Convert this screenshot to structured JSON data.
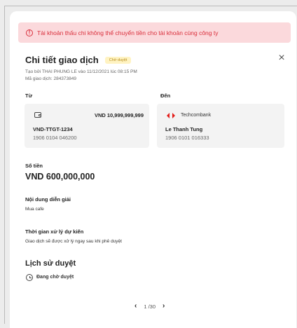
{
  "alert": {
    "icon": "alert-circle-icon",
    "text": "Tài khoản thấu chi không thể chuyển tiền cho tài khoản cùng công ty",
    "color": "#d92d3a",
    "background": "#fbd9dc"
  },
  "header": {
    "title": "Chi tiết giao dịch",
    "status_badge": "Chờ duyệt",
    "created_by": "Tạo bởi THAI PHUNG LE vào 11/12/2021 lúc 08:15 PM",
    "transaction_id": "Mã giao dịch: 284373849"
  },
  "from": {
    "label": "Từ",
    "icon": "wallet-icon",
    "balance": "VND 10,999,999,999",
    "account_name": "VND-TTGT-1234",
    "account_number": "1906 0104 046200"
  },
  "to": {
    "label": "Đến",
    "bank_icon": "techcombank-logo-icon",
    "bank_name": "Techcombank",
    "account_name": "Le Thanh Tung",
    "account_number": "1906 0101 016333"
  },
  "amount": {
    "label": "Số tiền",
    "value": "VND 600,000,000"
  },
  "description": {
    "label": "Nội dung diễn giải",
    "value": "Mua cafe"
  },
  "processing_time": {
    "label": "Thời gian xử lý dự kiến",
    "value": "Giao dịch sẽ được xử lý ngay sau khi phê duyệt"
  },
  "approval_history": {
    "title": "Lịch sử duyệt",
    "icon": "clock-icon",
    "status": "Đang chờ duyệt"
  },
  "pagination": {
    "current": "1",
    "text": "1 /30"
  },
  "colors": {
    "badge_bg": "#fff3c2",
    "badge_text": "#b58a1a",
    "techcombank_red": "#e31d1a"
  }
}
